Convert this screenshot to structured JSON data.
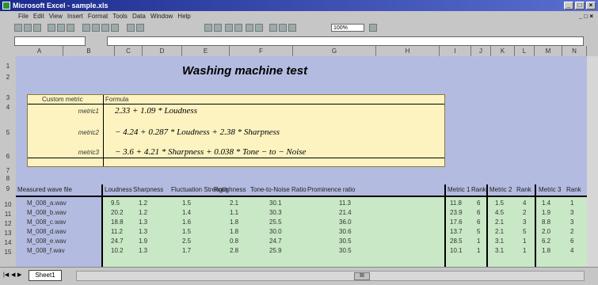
{
  "window": {
    "title": "Microsoft Excel - sample.xls"
  },
  "menu": [
    "File",
    "Edit",
    "View",
    "Insert",
    "Format",
    "Tools",
    "Data",
    "Window",
    "Help"
  ],
  "toolbar": {
    "zoom": "100%"
  },
  "columns": [
    "A",
    "B",
    "C",
    "D",
    "E",
    "F",
    "G",
    "H",
    "I",
    "J",
    "K",
    "L",
    "M",
    "N"
  ],
  "rows": [
    "1",
    "2",
    "3",
    "4",
    "5",
    "6",
    "7",
    "8",
    "9",
    "10",
    "11",
    "12",
    "13",
    "14",
    "15"
  ],
  "sheet": {
    "heading": "Washing machine test",
    "formula_panel": {
      "header_label": "Custom metric",
      "header_formula": "Formula",
      "metrics": [
        {
          "label": "metric1",
          "formula": "2.33 + 1.09 * Loudness"
        },
        {
          "label": "metric2",
          "formula": "− 4.24 + 0.287 * Loudness + 2.38 * Sharpness"
        },
        {
          "label": "metric3",
          "formula": "− 3.6 + 4.21 * Sharpness + 0.038 * Tone − to − Noise"
        }
      ]
    },
    "table": {
      "headers": [
        "Measured wave file",
        "Loudness",
        "Sharpness",
        "Fluctuation Strength",
        "Roughness",
        "Tone-to-Noise Ratio",
        "Prominence ratio",
        "Metric 1",
        "Rank",
        "Metric 2",
        "Rank",
        "Metric 3",
        "Rank"
      ],
      "rows": [
        [
          "10",
          "M_008_a.wav",
          "9.5",
          "1.2",
          "1.5",
          "2.1",
          "30.1",
          "11.3",
          "11.8",
          "6",
          "1.5",
          "4",
          "1.4",
          "1"
        ],
        [
          "11",
          "M_008_b.wav",
          "20.2",
          "1.2",
          "1.4",
          "1.1",
          "30.3",
          "21.4",
          "23.9",
          "6",
          "4.5",
          "2",
          "1.9",
          "3"
        ],
        [
          "12",
          "M_008_c.wav",
          "18.8",
          "1.3",
          "1.6",
          "1.8",
          "25.5",
          "36.0",
          "17.6",
          "6",
          "2.1",
          "3",
          "8.8",
          "3"
        ],
        [
          "13",
          "M_008_d.wav",
          "11.2",
          "1.3",
          "1.5",
          "1.8",
          "30.0",
          "30.6",
          "13.7",
          "5",
          "2.1",
          "5",
          "2.0",
          "2"
        ],
        [
          "14",
          "M_008_e.wav",
          "24.7",
          "1.9",
          "2.5",
          "0.8",
          "24.7",
          "30.5",
          "28.5",
          "1",
          "3.1",
          "1",
          "6.2",
          "6"
        ],
        [
          "15",
          "M_008_f.wav",
          "10.2",
          "1.3",
          "1.7",
          "2.8",
          "25.9",
          "30.5",
          "10.1",
          "1",
          "3.1",
          "1",
          "1.8",
          "4"
        ]
      ]
    }
  },
  "status": {
    "sheet_tab": "Sheet1"
  }
}
